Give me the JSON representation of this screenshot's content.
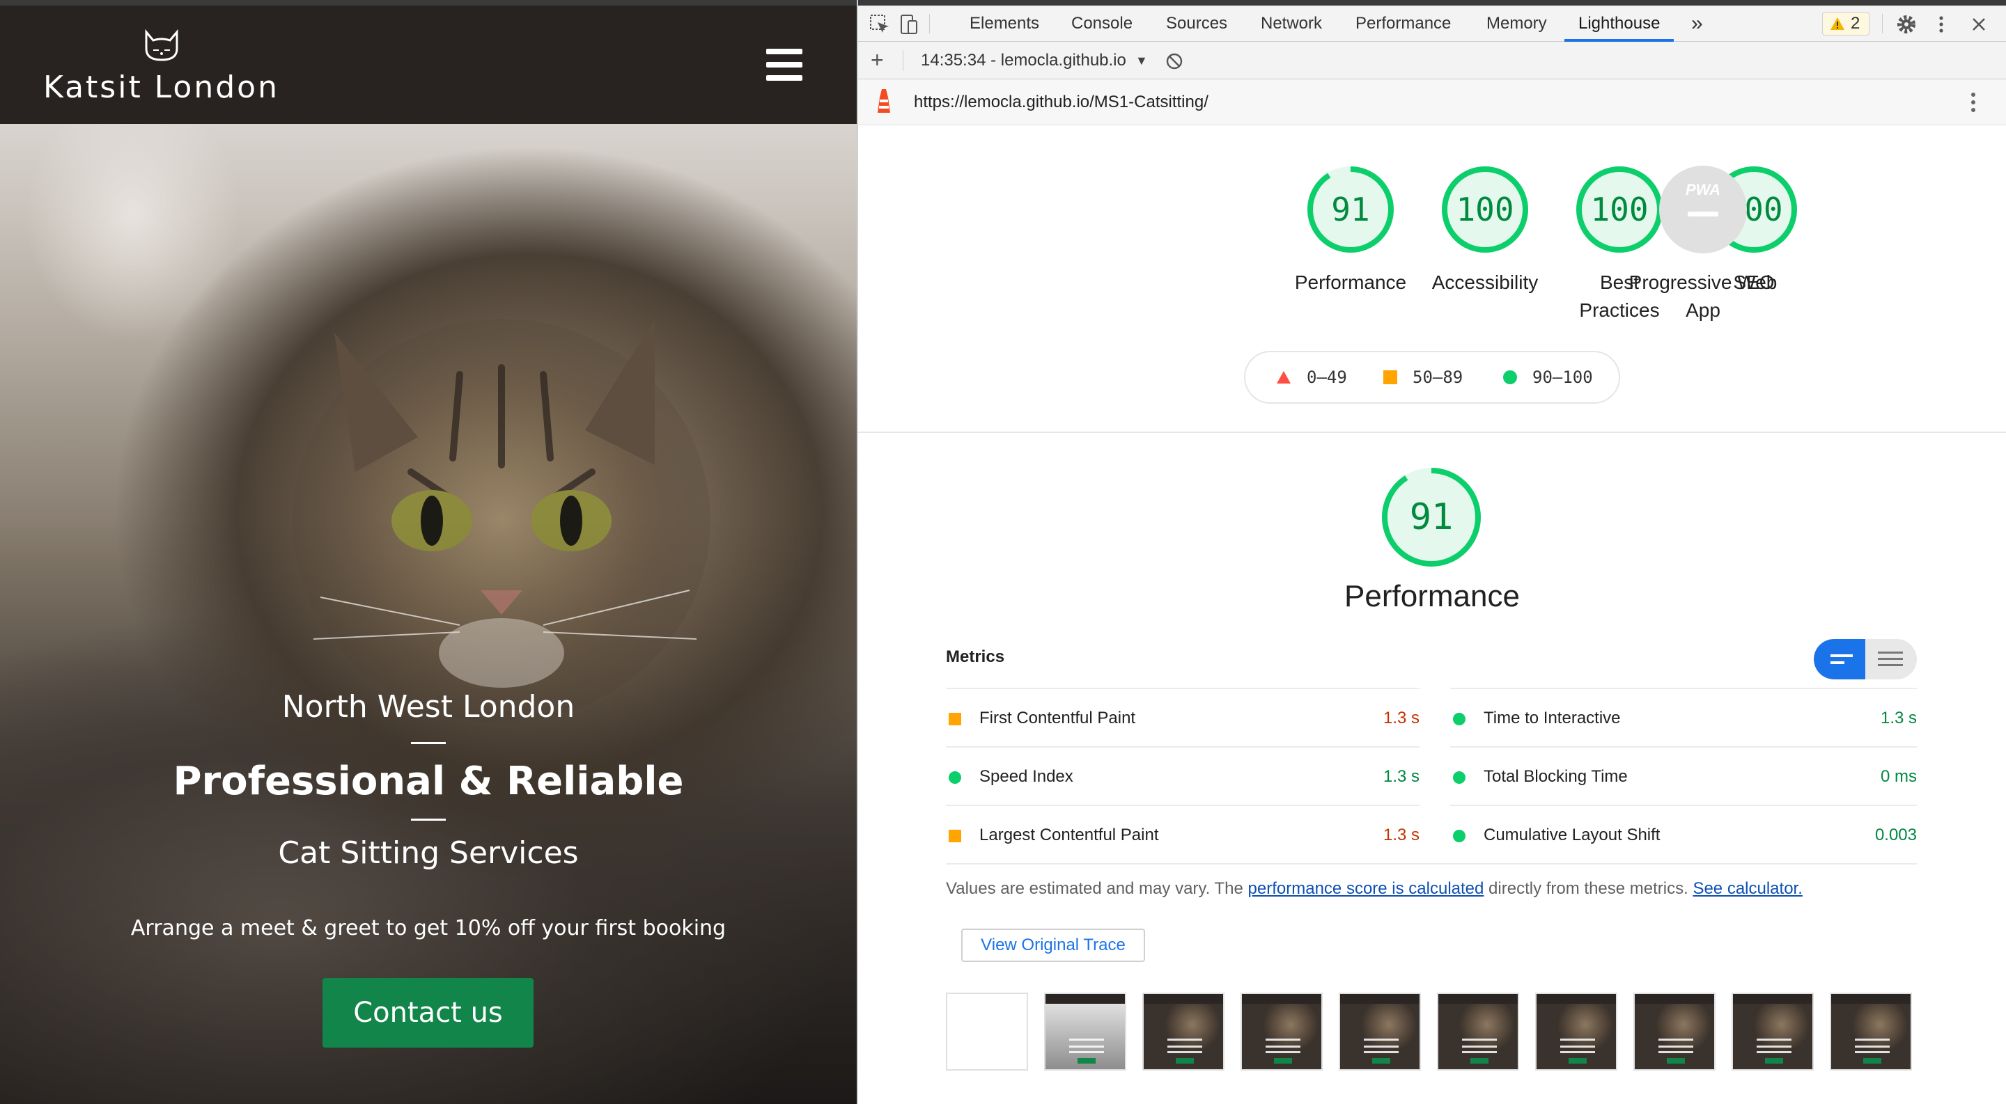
{
  "site": {
    "brand": "Katsit London",
    "hero": {
      "subtitle_top": "North West London",
      "headline": "Professional & Reliable",
      "subtitle_bottom": "Cat Sitting Services",
      "note": "Arrange a meet & greet to get 10% off your first booking",
      "cta": "Contact us"
    },
    "colors": {
      "nav_bg": "#282221",
      "cta_bg": "#11854a"
    }
  },
  "devtools": {
    "tabs": [
      "Elements",
      "Console",
      "Sources",
      "Network",
      "Performance",
      "Memory",
      "Lighthouse"
    ],
    "active_tab": "Lighthouse",
    "overflow_label": "»",
    "warnings": "2",
    "report_selector": "14:35:34 - lemocla.github.io",
    "report_caret": "▼",
    "url": "https://lemocla.github.io/MS1-Catsitting/"
  },
  "lighthouse": {
    "scores": [
      {
        "label": "Performance",
        "value": 91
      },
      {
        "label": "Accessibility",
        "value": 100
      },
      {
        "label": "Best Practices",
        "value": 100
      },
      {
        "label": "SEO",
        "value": 100
      }
    ],
    "pwa": {
      "label": "Progressive Web App",
      "badge": "PWA"
    },
    "legend": [
      "0–49",
      "50–89",
      "90–100"
    ],
    "performance": {
      "value": 91,
      "title": "Performance"
    },
    "metrics_title": "Metrics",
    "metrics": [
      {
        "name": "First Contentful Paint",
        "value": "1.3 s",
        "status": "average"
      },
      {
        "name": "Time to Interactive",
        "value": "1.3 s",
        "status": "pass"
      },
      {
        "name": "Speed Index",
        "value": "1.3 s",
        "status": "pass"
      },
      {
        "name": "Total Blocking Time",
        "value": "0 ms",
        "status": "pass"
      },
      {
        "name": "Largest Contentful Paint",
        "value": "1.3 s",
        "status": "average"
      },
      {
        "name": "Cumulative Layout Shift",
        "value": "0.003",
        "status": "pass"
      }
    ],
    "note": {
      "prefix": "Values are estimated and may vary. The ",
      "link1": "performance score is calculated",
      "middle": " directly from these metrics. ",
      "link2": "See calculator."
    },
    "trace_button": "View Original Trace",
    "colors": {
      "pass": "#0cce6b",
      "average": "#ffa400",
      "fail": "#ff4e42",
      "accent": "#1a73e8"
    }
  }
}
